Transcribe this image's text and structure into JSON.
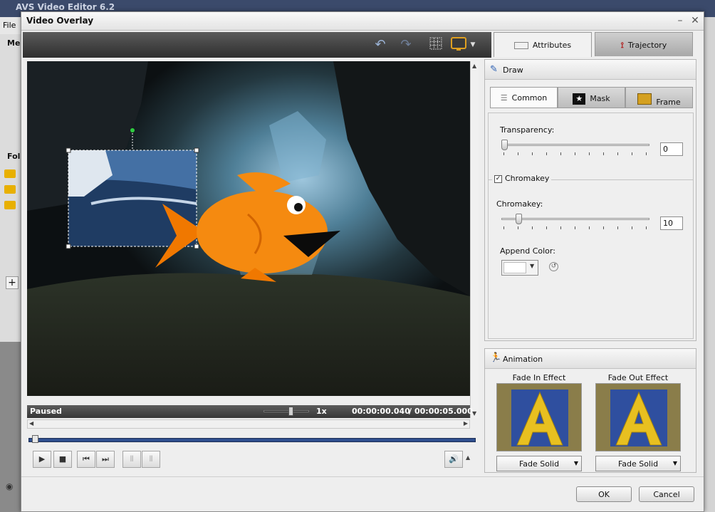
{
  "background_app": {
    "title": "AVS Video Editor 6.2",
    "menu_file": "File",
    "menu_partial": "Me",
    "folder_partial": "Fol"
  },
  "dialog": {
    "title": "Video Overlay",
    "minimize": "–",
    "close": "✕"
  },
  "tabs": [
    {
      "label": "Attributes",
      "active": true
    },
    {
      "label": "Trajectory",
      "active": false
    }
  ],
  "player": {
    "status": "Paused",
    "speed": "1x",
    "current_time": "00:00:00.040",
    "separator": "/",
    "total_time": "00:00:05.000",
    "seek_progress": 0.008,
    "speed_slider_level": 0.6
  },
  "draw": {
    "header": "Draw",
    "subtabs": [
      {
        "label": "Common",
        "active": true
      },
      {
        "label": "Mask",
        "active": false
      },
      {
        "label": "Frame",
        "active": false
      }
    ],
    "transparency_label": "Transparency:",
    "transparency_value": "0",
    "transparency_level": 0,
    "chromakey_check_label": "Chromakey",
    "chromakey_checked": true,
    "chromakey_label": "Chromakey:",
    "chromakey_value": "10",
    "chromakey_level": 0.1,
    "append_color_label": "Append Color:",
    "append_color_value": "#ffffff"
  },
  "animation": {
    "header": "Animation",
    "fade_in_label": "Fade In Effect",
    "fade_out_label": "Fade Out Effect",
    "fade_in_value": "Fade Solid",
    "fade_out_value": "Fade Solid"
  },
  "buttons": {
    "ok": "OK",
    "cancel": "Cancel"
  },
  "colors": {
    "fish": "#f07800",
    "toolbar_dark": "#3a3a3a",
    "timeline_blue": "#2f4f8f"
  }
}
